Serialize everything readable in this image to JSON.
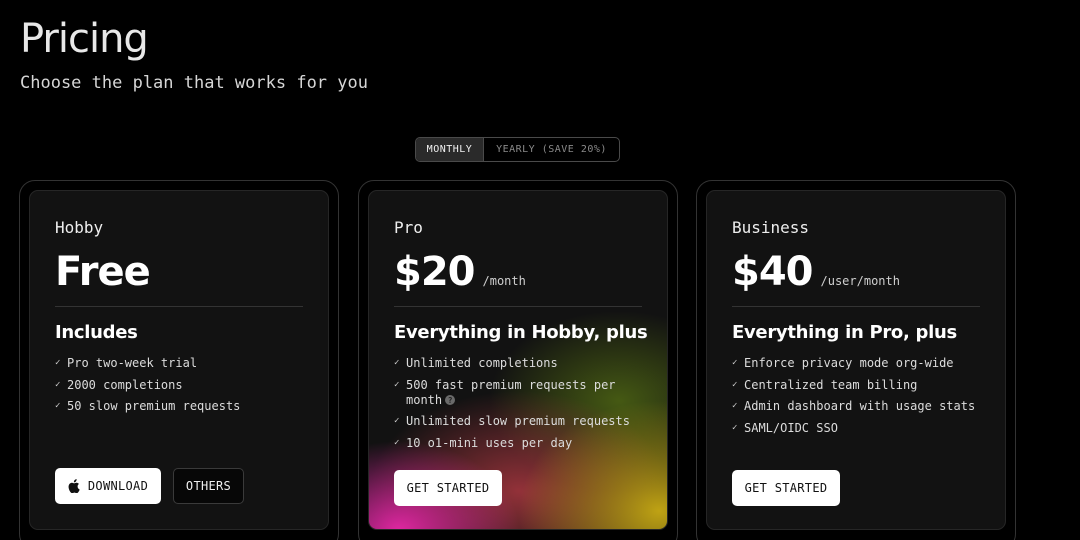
{
  "header": {
    "title": "Pricing",
    "subtitle": "Choose the plan that works for you"
  },
  "billing_toggle": {
    "monthly_label": "MONTHLY",
    "yearly_label": "YEARLY (SAVE 20%)",
    "selected": "MONTHLY"
  },
  "plans": [
    {
      "name": "Hobby",
      "price": "Free",
      "period": "",
      "includes_heading": "Includes",
      "features": [
        "Pro two-week trial",
        "2000 completions",
        "50 slow premium requests"
      ],
      "buttons": [
        {
          "label": "DOWNLOAD",
          "icon": "apple-icon"
        },
        {
          "label": "OTHERS"
        }
      ]
    },
    {
      "name": "Pro",
      "price": "$20",
      "period": "/month",
      "includes_heading": "Everything in Hobby, plus",
      "features": [
        "Unlimited completions",
        "500 fast premium requests per month",
        "Unlimited slow premium requests",
        "10 o1-mini uses per day"
      ],
      "info_icon": "?",
      "buttons": [
        {
          "label": "GET STARTED"
        }
      ]
    },
    {
      "name": "Business",
      "price": "$40",
      "period": "/user/month",
      "includes_heading": "Everything in Pro, plus",
      "features": [
        "Enforce privacy mode org-wide",
        "Centralized team billing",
        "Admin dashboard with usage stats",
        "SAML/OIDC SSO"
      ],
      "buttons": [
        {
          "label": "GET STARTED"
        }
      ]
    }
  ],
  "colors": {
    "background": "#000000",
    "card": "#121212",
    "pro_gradient_pink": "#eb28aa",
    "pro_gradient_yellow": "#c8aa14"
  }
}
